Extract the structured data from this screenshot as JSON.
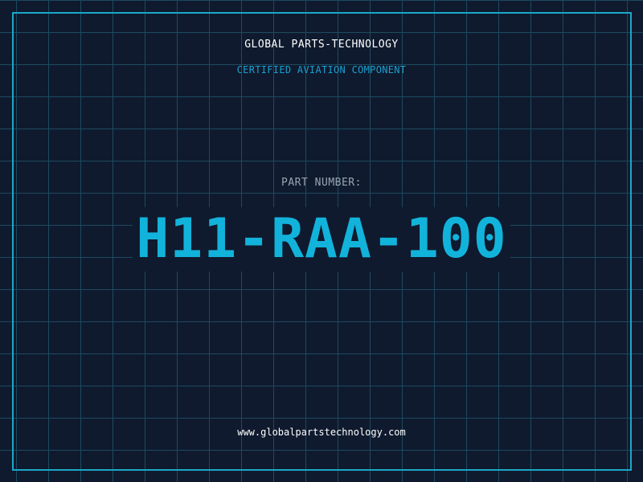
{
  "header": {
    "company": "GLOBAL PARTS-TECHNOLOGY",
    "tagline": "CERTIFIED AVIATION COMPONENT"
  },
  "part": {
    "label": "PART NUMBER:",
    "number": "H11-RAA-100"
  },
  "footer": {
    "website": "www.globalpartstechnology.com"
  },
  "colors": {
    "background": "#0f1a2e",
    "grid": "#1d4a5e",
    "frame": "#1aa8c8",
    "accent": "#12b3db",
    "tagline": "#1a9fd0",
    "label": "#9aa5b3",
    "text": "#ffffff"
  }
}
